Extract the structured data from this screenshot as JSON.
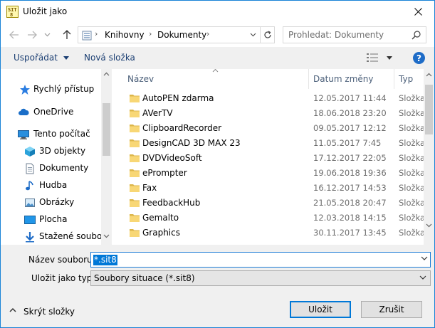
{
  "window": {
    "title": "Uložit jako",
    "accent_color": "#0078d7"
  },
  "address_bar": {
    "breadcrumbs": [
      "Knihovny",
      "Dokumenty"
    ],
    "search_placeholder": "Prohledat: Dokumenty"
  },
  "toolbar": {
    "organize_label": "Uspořádat",
    "new_folder_label": "Nová složka",
    "help_label": "?"
  },
  "sidebar": {
    "items": [
      {
        "label": "Rychlý přístup",
        "icon": "star-icon"
      },
      {
        "label": "OneDrive",
        "icon": "cloud-icon"
      },
      {
        "label": "Tento počítač",
        "icon": "computer-icon"
      },
      {
        "label": "3D objekty",
        "icon": "cube-icon"
      },
      {
        "label": "Dokumenty",
        "icon": "document-icon"
      },
      {
        "label": "Hudba",
        "icon": "music-icon"
      },
      {
        "label": "Obrázky",
        "icon": "pictures-icon"
      },
      {
        "label": "Plocha",
        "icon": "desktop-icon"
      },
      {
        "label": "Stažené soubory",
        "icon": "download-icon"
      }
    ]
  },
  "filelist": {
    "columns": {
      "name": "Název",
      "date": "Datum změny",
      "type": "Typ"
    },
    "rows": [
      {
        "name": "AutoPEN zdarma",
        "date": "12.05.2017 11:44",
        "type": "Složka"
      },
      {
        "name": "AVerTV",
        "date": "18.06.2018 23:20",
        "type": "Složka"
      },
      {
        "name": "ClipboardRecorder",
        "date": "09.05.2017 12:12",
        "type": "Složka"
      },
      {
        "name": "DesignCAD 3D MAX 23",
        "date": "11.05.2017 7:45",
        "type": "Složka"
      },
      {
        "name": "DVDVideoSoft",
        "date": "17.12.2017 22:05",
        "type": "Složka"
      },
      {
        "name": "ePrompter",
        "date": "19.06.2018 19:36",
        "type": "Složka"
      },
      {
        "name": "Fax",
        "date": "16.12.2017 14:53",
        "type": "Složka"
      },
      {
        "name": "FeedbackHub",
        "date": "21.05.2018 20:47",
        "type": "Složka"
      },
      {
        "name": "Gemalto",
        "date": "12.03.2018 14:15",
        "type": "Složka"
      },
      {
        "name": "Graphics",
        "date": "30.11.2017 13:45",
        "type": "Složka"
      }
    ]
  },
  "form": {
    "filename_label": "Název souboru:",
    "filename_value": "*.sit8",
    "savetype_label": "Uložit jako typ:",
    "savetype_value": "Soubory situace (*.sit8)",
    "hide_folders_label": "Skrýt složky",
    "save_button": "Uložit",
    "cancel_button": "Zrušit"
  }
}
